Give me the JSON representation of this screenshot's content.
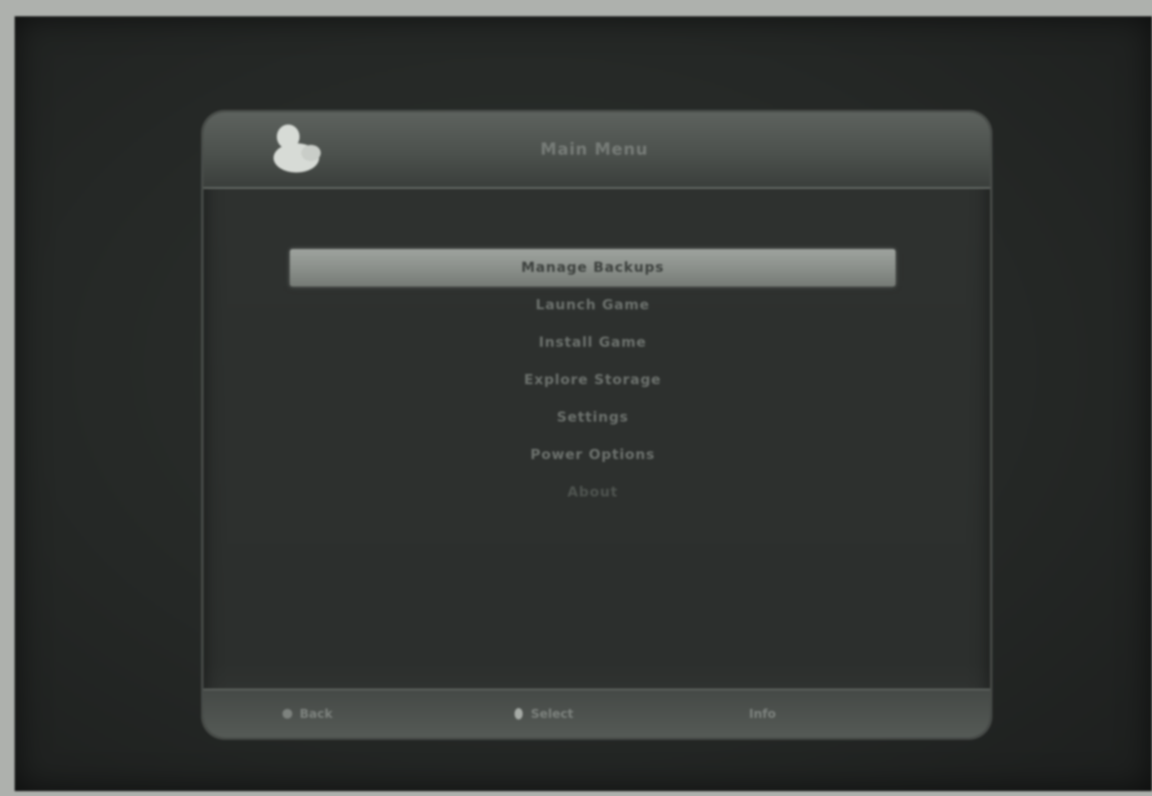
{
  "header": {
    "logo_icon": "duck-logo-icon",
    "title": "Main Menu"
  },
  "menu": {
    "items": [
      {
        "label": "Manage Backups"
      },
      {
        "label": "Launch Game"
      },
      {
        "label": "Install Game"
      },
      {
        "label": "Explore Storage"
      },
      {
        "label": "Settings"
      },
      {
        "label": "Power Options"
      },
      {
        "label": "About"
      }
    ]
  },
  "footer": {
    "back": {
      "icon": "back-button-icon",
      "label": "Back"
    },
    "select": {
      "icon": "select-button-icon",
      "label": "Select"
    },
    "info": {
      "label": "Info"
    }
  },
  "colors": {
    "screen_bg": "#252826",
    "highlight": "#9ea39e",
    "menu_text": "#6c716d"
  }
}
